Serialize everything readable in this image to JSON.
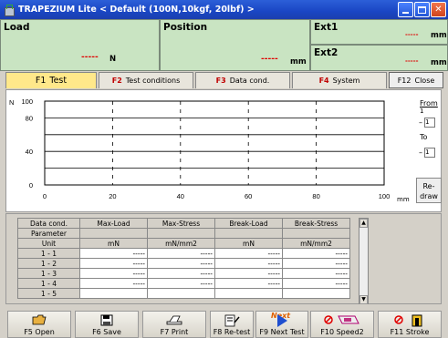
{
  "window": {
    "title": "TRAPEZIUM Lite < Default (100N,10kgf, 20lbf) >"
  },
  "readouts": {
    "load": {
      "label": "Load",
      "value": "-----",
      "unit": "N"
    },
    "position": {
      "label": "Position",
      "value": "-----",
      "unit": "mm"
    },
    "ext1": {
      "label": "Ext1",
      "value": "-----",
      "unit": "mm"
    },
    "ext2": {
      "label": "Ext2",
      "value": "-----",
      "unit": "mm"
    }
  },
  "tabs": [
    {
      "key": "F1",
      "label": "Test"
    },
    {
      "key": "F2",
      "label": "Test conditions"
    },
    {
      "key": "F3",
      "label": "Data cond."
    },
    {
      "key": "F4",
      "label": "System"
    },
    {
      "key": "F12",
      "label": "Close"
    }
  ],
  "chart_data": {
    "type": "line",
    "ylabel": "N",
    "xlabel": "mm",
    "xlim": [
      0,
      100
    ],
    "ylim": [
      0,
      100
    ],
    "x_ticks": [
      "0",
      "20",
      "40",
      "60",
      "80",
      "100"
    ],
    "y_ticks": [
      "0",
      "40",
      "80",
      "100"
    ],
    "series": [],
    "grid": true
  },
  "range_panel": {
    "from_label": "From",
    "from_value": "1",
    "from_box": "1",
    "to_label": "To",
    "to_box": "1",
    "redraw_label": "Re-draw"
  },
  "table": {
    "header": [
      "Data cond.",
      "Max-Load",
      "Max-Stress",
      "Break-Load",
      "Break-Stress"
    ],
    "param_label": "Parameter",
    "unit_row": [
      "Unit",
      "mN",
      "mN/mm2",
      "mN",
      "mN/mm2"
    ],
    "rows": [
      {
        "label": "1 - 1",
        "cells": [
          "-----",
          "-----",
          "-----",
          "-----"
        ]
      },
      {
        "label": "1 - 2",
        "cells": [
          "-----",
          "-----",
          "-----",
          "-----"
        ]
      },
      {
        "label": "1 - 3",
        "cells": [
          "-----",
          "-----",
          "-----",
          "-----"
        ]
      },
      {
        "label": "1 - 4",
        "cells": [
          "-----",
          "-----",
          "-----",
          "-----"
        ]
      },
      {
        "label": "1 - 5",
        "cells": [
          "",
          "",
          "",
          ""
        ]
      }
    ]
  },
  "toolbar": {
    "open": "F5  Open",
    "save": "F6  Save",
    "print": "F7  Print",
    "retest": "F8 Re-test",
    "nexttest": "F9 Next Test",
    "next_overlay": "Next",
    "speed2": "F10 Speed2",
    "stroke": "F11  Stroke"
  }
}
